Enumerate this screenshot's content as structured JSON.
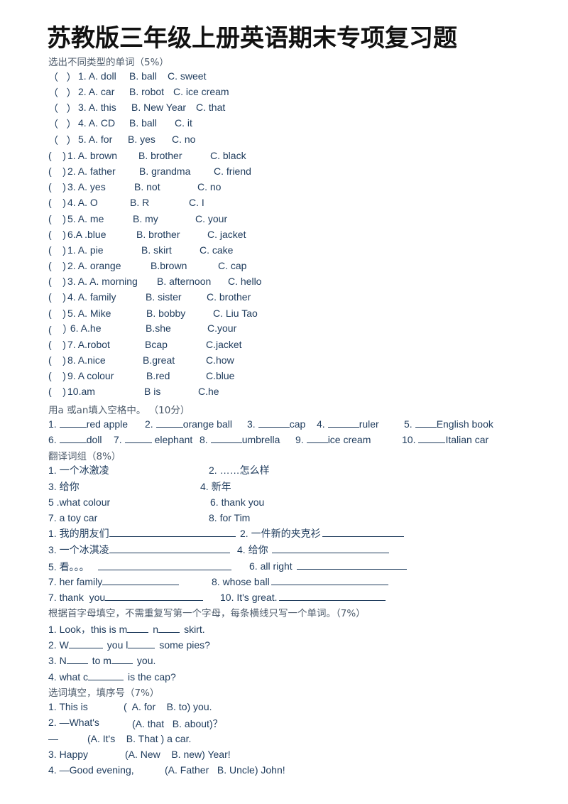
{
  "title": "苏教版三年级上册英语期末专项复习题",
  "section1": {
    "heading": "选出不同类型的单词（5%）",
    "items": [
      {
        "paren": "（   ）",
        "num": "1. A. doll",
        "b": "B. ball",
        "c": "C. sweet"
      },
      {
        "paren": "（   ）",
        "num": "2. A. car",
        "b": "B. robot",
        "c": "C. ice cream"
      },
      {
        "paren": "（   ）",
        "num": "3. A. this",
        "b": "B. New Year",
        "c": "C. that"
      },
      {
        "paren": "（   ）",
        "num": "4. A. CD",
        "b": "B. ball",
        "c": "C. it"
      },
      {
        "paren": "（   ）",
        "num": "5. A. for",
        "b": "B. yes",
        "c": "C. no"
      }
    ]
  },
  "section2": {
    "items": [
      {
        "paren": "(    )",
        "a": "1. A. brown",
        "b": "B. brother",
        "c": "C. black"
      },
      {
        "paren": "(    )",
        "a": "2. A. father",
        "b": "B. grandma",
        "c": "C. friend"
      },
      {
        "paren": "(    )",
        "a": "3. A. yes",
        "b": "B. not",
        "c": "C. no"
      },
      {
        "paren": "(    )",
        "a": "4. A. O",
        "b": "B. R",
        "c": "C. I"
      },
      {
        "paren": "(    )",
        "a": "5. A. me",
        "b": "B. my",
        "c": "C. your"
      },
      {
        "paren": "(    )",
        "a": "6.A .blue",
        "b": "B. brother",
        "c": "C. jacket"
      },
      {
        "paren": "(    )",
        "a": "1. A. pie",
        "b": "B. skirt",
        "c": "C. cake"
      },
      {
        "paren": "(    )",
        "a": "2. A. orange",
        "b": "B.brown",
        "c": "C. cap"
      },
      {
        "paren": "(    )",
        "a": "3. A. A. morning",
        "b": "B. afternoon",
        "c": "C. hello"
      },
      {
        "paren": "(    )",
        "a": "4. A. family",
        "b": "B. sister",
        "c": "C. brother"
      },
      {
        "paren": "(    )",
        "a": "5. A. Mike",
        "b": "B. bobby",
        "c": "C. Liu Tao"
      },
      {
        "paren": "(    ）",
        "a": " 6. A.he",
        "b": "B.she",
        "c": "C.your"
      },
      {
        "paren": "(    )",
        "a": "7. A.robot",
        "b": "Bcap",
        "c": "C.jacket"
      },
      {
        "paren": "(    )",
        "a": "8. A.nice",
        "b": "B.great",
        "c": "C.how"
      },
      {
        "paren": "(    )",
        "a": "9. A colour",
        "b": "B.red",
        "c": "C.blue"
      },
      {
        "paren": "(    )",
        "a": "10.am",
        "b": "B is",
        "c": "C.he"
      }
    ]
  },
  "section3": {
    "heading": "用a 或an填入空格中。 （10分）",
    "row1": [
      {
        "num": "1.",
        "word": "red apple"
      },
      {
        "num": "2.",
        "word": "orange ball"
      },
      {
        "num": "3.",
        "word": "cap"
      },
      {
        "num": "4.",
        "word": "ruler"
      },
      {
        "num": "5.",
        "word": "English book"
      }
    ],
    "row2": [
      {
        "num": "6.",
        "word": "doll"
      },
      {
        "num": "7.",
        "word": " elephant"
      },
      {
        "num": "8.",
        "word": "umbrella"
      },
      {
        "num": "9.",
        "word": "ice cream"
      },
      {
        "num": "10.",
        "word": "Italian car"
      }
    ]
  },
  "section4": {
    "heading": "翻译词组（8%）",
    "pairs": [
      {
        "left": "1. 一个冰激凌",
        "right": "2. ……怎么样"
      },
      {
        "left": "3. 给你",
        "right": "4. 新年"
      },
      {
        "left": "5 .what colour",
        "right": "6. thank you"
      },
      {
        "left": "7. a toy car",
        "right": "8. for Tim"
      }
    ],
    "blank_pairs": [
      {
        "left": "1. 我的朋友们",
        "right": "2. 一件新的夹克衫"
      },
      {
        "left": "3. 一个冰淇凌",
        "right": "4. 给你 "
      },
      {
        "left": "5. 看。。。",
        "right": "6. all right "
      },
      {
        "left": "7. her family",
        "right": "8. whose ball"
      },
      {
        "left": "7. thank  you",
        "right": "10. It's great."
      }
    ]
  },
  "section5": {
    "heading": "根据首字母填空，不需重复写第一个字母，每条横线只写一个单词。（7%）",
    "items": [
      [
        "1. Look，this is m",
        "n",
        "skirt."
      ],
      [
        "2. W",
        "you l",
        "some pies?"
      ],
      [
        "3. N",
        "to m",
        "you."
      ],
      [
        "4. what c",
        "is the cap?"
      ]
    ]
  },
  "section6": {
    "heading": "选词填空，填序号（7%）",
    "items": [
      {
        "stem": "1. This is",
        "opts": "(  A. for    B. to) you."
      },
      {
        "stem": "2. —What's",
        "opts": "(A. that   B. about)？"
      },
      {
        "stem": "—",
        "opts": "(A. It's    B. That ) a car."
      },
      {
        "stem": "3. Happy",
        "opts": "(A. New    B. new) Year!"
      },
      {
        "stem": "4. —Good evening,",
        "opts": "(A. Father   B. Uncle) John!"
      }
    ]
  }
}
